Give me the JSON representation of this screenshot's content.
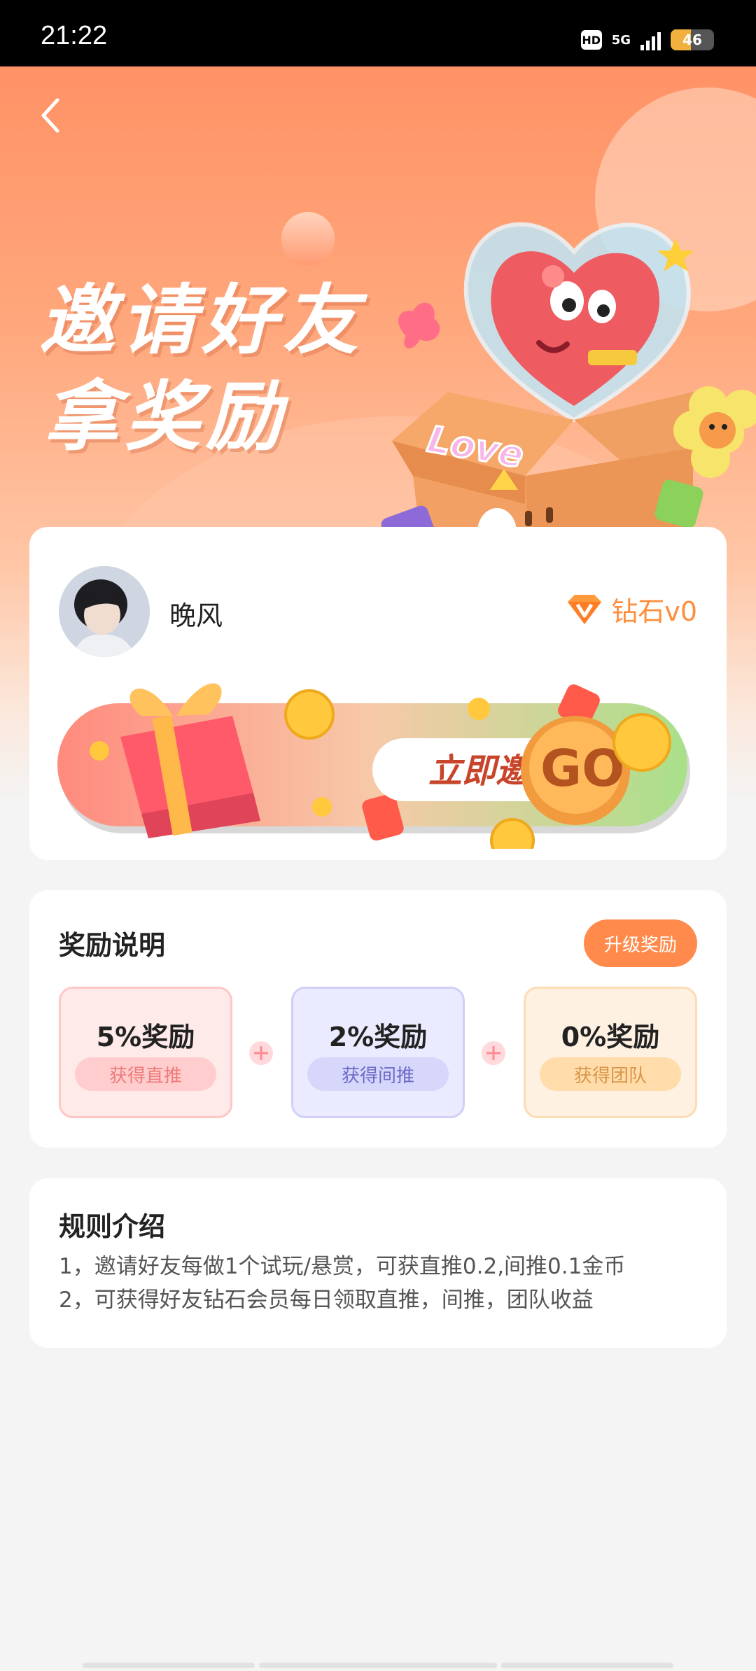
{
  "status_bar": {
    "time": "21:22",
    "hd_label": "HD",
    "network_label": "5G",
    "battery_level": "46"
  },
  "hero": {
    "back_icon": "chevron-left-icon",
    "title_line1": "邀请好友",
    "title_line2": "拿奖励"
  },
  "user": {
    "name": "晚风",
    "level": "钻石v0",
    "level_icon": "diamond-v-icon"
  },
  "invite_banner": {
    "label": "立即邀请",
    "go_label": "GO"
  },
  "rewards": {
    "title": "奖励说明",
    "upgrade_label": "升级奖励",
    "items": [
      {
        "title": "5%奖励",
        "subtitle": "获得直推",
        "accent": "#f08a8a"
      },
      {
        "title": "2%奖励",
        "subtitle": "获得间推",
        "accent": "#7b77d6"
      },
      {
        "title": "0%奖励",
        "subtitle": "获得团队",
        "accent": "#e6a85c"
      }
    ]
  },
  "rules": {
    "title": "规则介绍",
    "lines": [
      "1，邀请好友每做1个试玩/悬赏，可获直推0.2,间推0.1金币",
      "2，可获得好友钻石会员每日领取直推，间推，团队收益"
    ]
  },
  "colors": {
    "accent": "#ff8a4c",
    "hero_top": "#ff9266",
    "background": "#f4f4f4"
  }
}
